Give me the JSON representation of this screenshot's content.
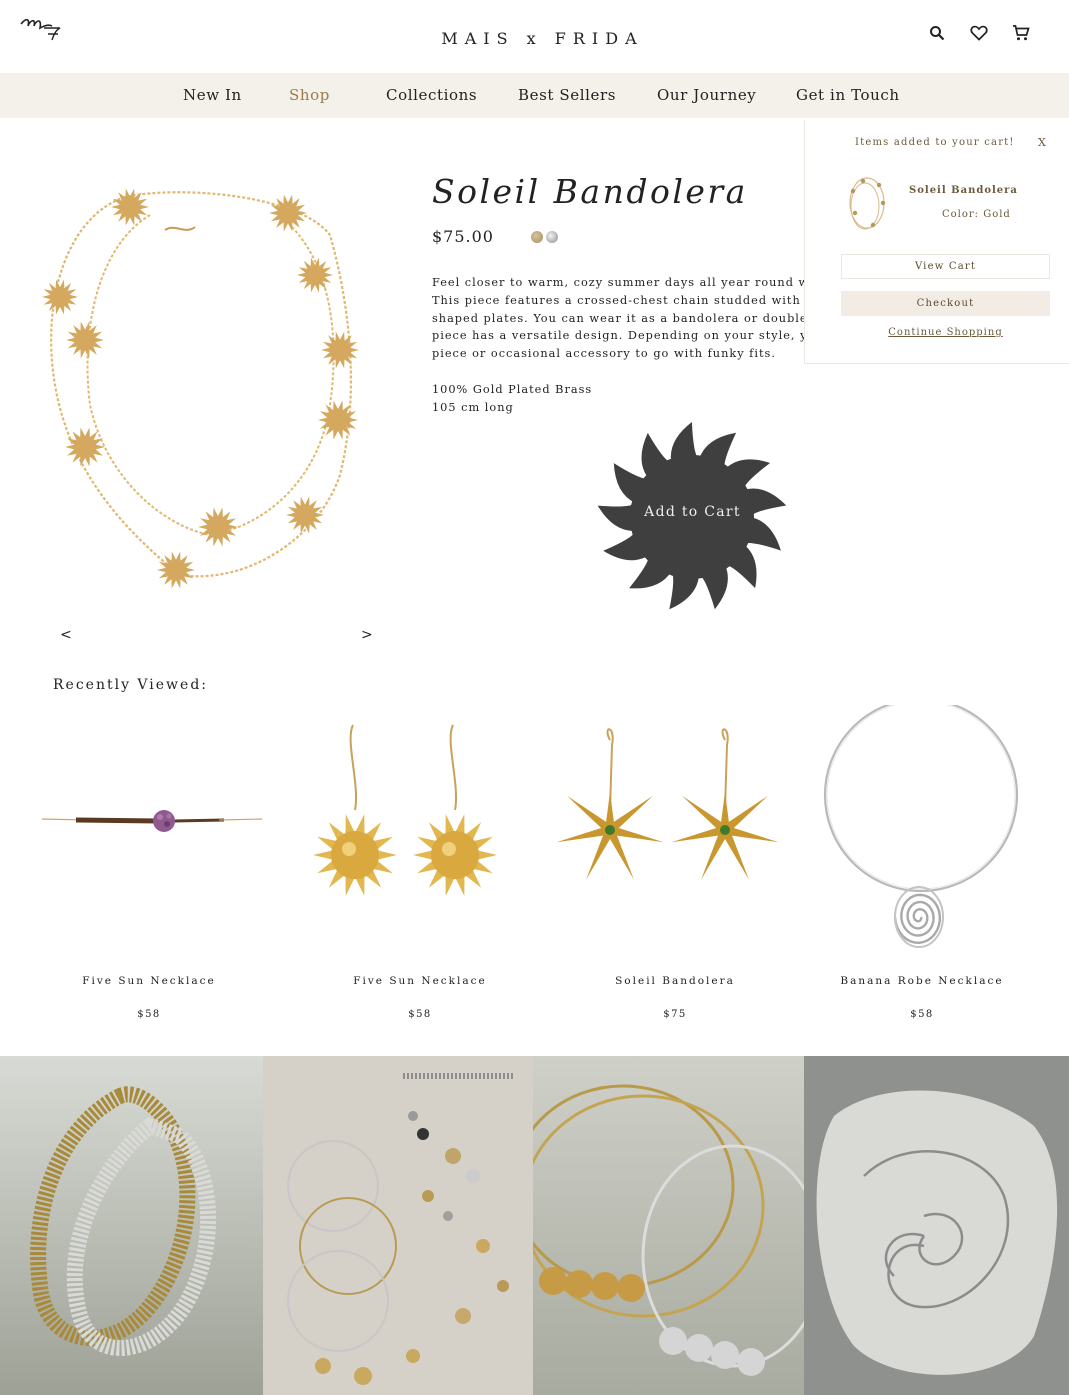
{
  "header": {
    "brand": "MAIS x FRIDA",
    "logo_text": "MF"
  },
  "nav": {
    "items": [
      {
        "label": "New In"
      },
      {
        "label": "Shop",
        "active": true
      },
      {
        "label": "Collections"
      },
      {
        "label": "Best Sellers"
      },
      {
        "label": "Our Journey"
      },
      {
        "label": "Get in Touch"
      }
    ]
  },
  "product": {
    "title": "Soleil Bandolera",
    "price": "$75.00",
    "swatches": [
      "Gold",
      "Silver"
    ],
    "description_lines": [
      "Feel closer to warm, cozy summer days all year round w",
      "This piece features a crossed-chest chain studded with",
      "shaped plates. You can wear it as a bandolera or double",
      "piece has a versatile design. Depending on your style, y",
      "piece or occasional accessory to go with funky fits."
    ],
    "spec_material": "100% Gold Plated Brass",
    "spec_length": "105 cm long",
    "add_to_cart_label": "Add to Cart",
    "prev_arrow": "<",
    "next_arrow": ">"
  },
  "cart_popup": {
    "title": "Items added to your cart!",
    "close_label": "X",
    "item_name": "Soleil Bandolera",
    "item_color": "Color: Gold",
    "view_cart_label": "View Cart",
    "checkout_label": "Checkout",
    "continue_label": "Continue Shopping"
  },
  "recently_viewed": {
    "title": "Recently Viewed:",
    "items": [
      {
        "name": "Five Sun Necklace",
        "price": "$58",
        "image": "bracelet-with-purple-stone"
      },
      {
        "name": "Five Sun Necklace",
        "price": "$58",
        "image": "sun-earrings-gold"
      },
      {
        "name": "Soleil Bandolera",
        "price": "$75",
        "image": "starfish-earrings-gold"
      },
      {
        "name": "Banana Robe Necklace",
        "price": "$58",
        "image": "spiral-pendant-choker-silver"
      }
    ]
  },
  "gallery": {
    "tiles": [
      "textured-chain-necklaces",
      "jewelry-flatlay",
      "hoop-chokers-with-beads",
      "spiral-earrings-on-shell"
    ]
  },
  "colors": {
    "nav_bg": "#f4f0ea",
    "accent_gold": "#9a7e46",
    "atc_sun": "#3f3f3f",
    "cart_text": "#6b5a3a"
  }
}
